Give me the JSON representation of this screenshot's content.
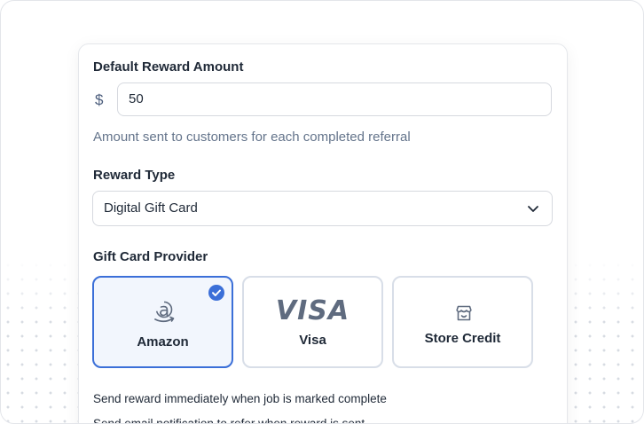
{
  "reward_amount": {
    "label": "Default Reward Amount",
    "currency_symbol": "$",
    "value": "50",
    "hint": "Amount sent to customers for each completed referral"
  },
  "reward_type": {
    "label": "Reward Type",
    "selected": "Digital Gift Card"
  },
  "provider": {
    "label": "Gift Card Provider",
    "options": [
      {
        "label": "Amazon",
        "icon": "amazon-icon",
        "selected": true
      },
      {
        "label": "Visa",
        "icon": "visa-logo",
        "logo_text": "VISA",
        "selected": false
      },
      {
        "label": "Store Credit",
        "icon": "store-icon",
        "selected": false
      }
    ]
  },
  "settings": {
    "send_immediately": "Send reward immediately when job is marked complete",
    "email_notification": "Send email notification to refer when reward is sent"
  },
  "colors": {
    "accent": "#3b6fd8",
    "muted_text": "#64748b"
  }
}
